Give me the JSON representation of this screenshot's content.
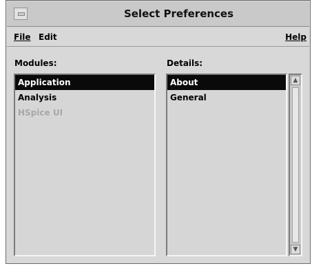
{
  "window": {
    "title": "Select Preferences"
  },
  "menubar": {
    "file": "File",
    "edit": "Edit",
    "help": "Help"
  },
  "modules": {
    "label": "Modules:",
    "items": [
      {
        "label": "Application",
        "selected": true,
        "disabled": false
      },
      {
        "label": "Analysis",
        "selected": false,
        "disabled": false
      },
      {
        "label": "HSpice UI",
        "selected": false,
        "disabled": true
      }
    ]
  },
  "details": {
    "label": "Details:",
    "items": [
      {
        "label": "About",
        "selected": true
      },
      {
        "label": "General",
        "selected": false
      }
    ]
  },
  "icons": {
    "system_menu": "window-menu-icon",
    "scroll_up": "scroll-up-arrow-icon",
    "scroll_down": "scroll-down-arrow-icon"
  },
  "colors": {
    "selection_bg": "#0a0a0a",
    "selection_fg": "#ffffff",
    "disabled_fg": "#a8a8a8"
  }
}
